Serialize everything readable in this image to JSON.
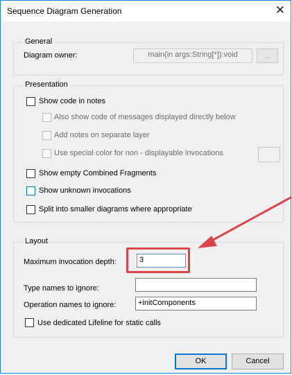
{
  "window": {
    "title": "Sequence Diagram Generation",
    "close_icon": "close-icon",
    "close_glyph": "✕"
  },
  "general": {
    "legend": "General",
    "owner_label": "Diagram owner:",
    "owner_value": "main(in args:String[*]):void",
    "browse_label": "..."
  },
  "presentation": {
    "legend": "Presentation",
    "show_code": {
      "label": "Show code in notes",
      "checked": false
    },
    "also_show": {
      "label": "Also show code of messages displayed directly below",
      "enabled": false
    },
    "add_notes": {
      "label": "Add notes on separate layer",
      "enabled": false
    },
    "special_color": {
      "label": "Use special color for non - displayable invocations",
      "enabled": false
    },
    "show_empty": {
      "label": "Show empty Combined Fragments",
      "checked": false
    },
    "show_unknown": {
      "label": "Show unknown invocations",
      "checked": false
    },
    "split": {
      "label": "Split into smaller diagrams where appropriate",
      "checked": false
    }
  },
  "layout": {
    "legend": "Layout",
    "max_depth_label": "Maximum invocation depth:",
    "max_depth_value": "3",
    "type_names_label": "Type names to ignore:",
    "type_names_value": "",
    "op_names_label": "Operation names to ignore:",
    "op_names_value": "+initComponents",
    "dedicated_lifeline": {
      "label": "Use dedicated Lifeline for static calls",
      "checked": false
    }
  },
  "buttons": {
    "ok": "OK",
    "cancel": "Cancel"
  },
  "annotation": {
    "color": "#d9454b"
  }
}
